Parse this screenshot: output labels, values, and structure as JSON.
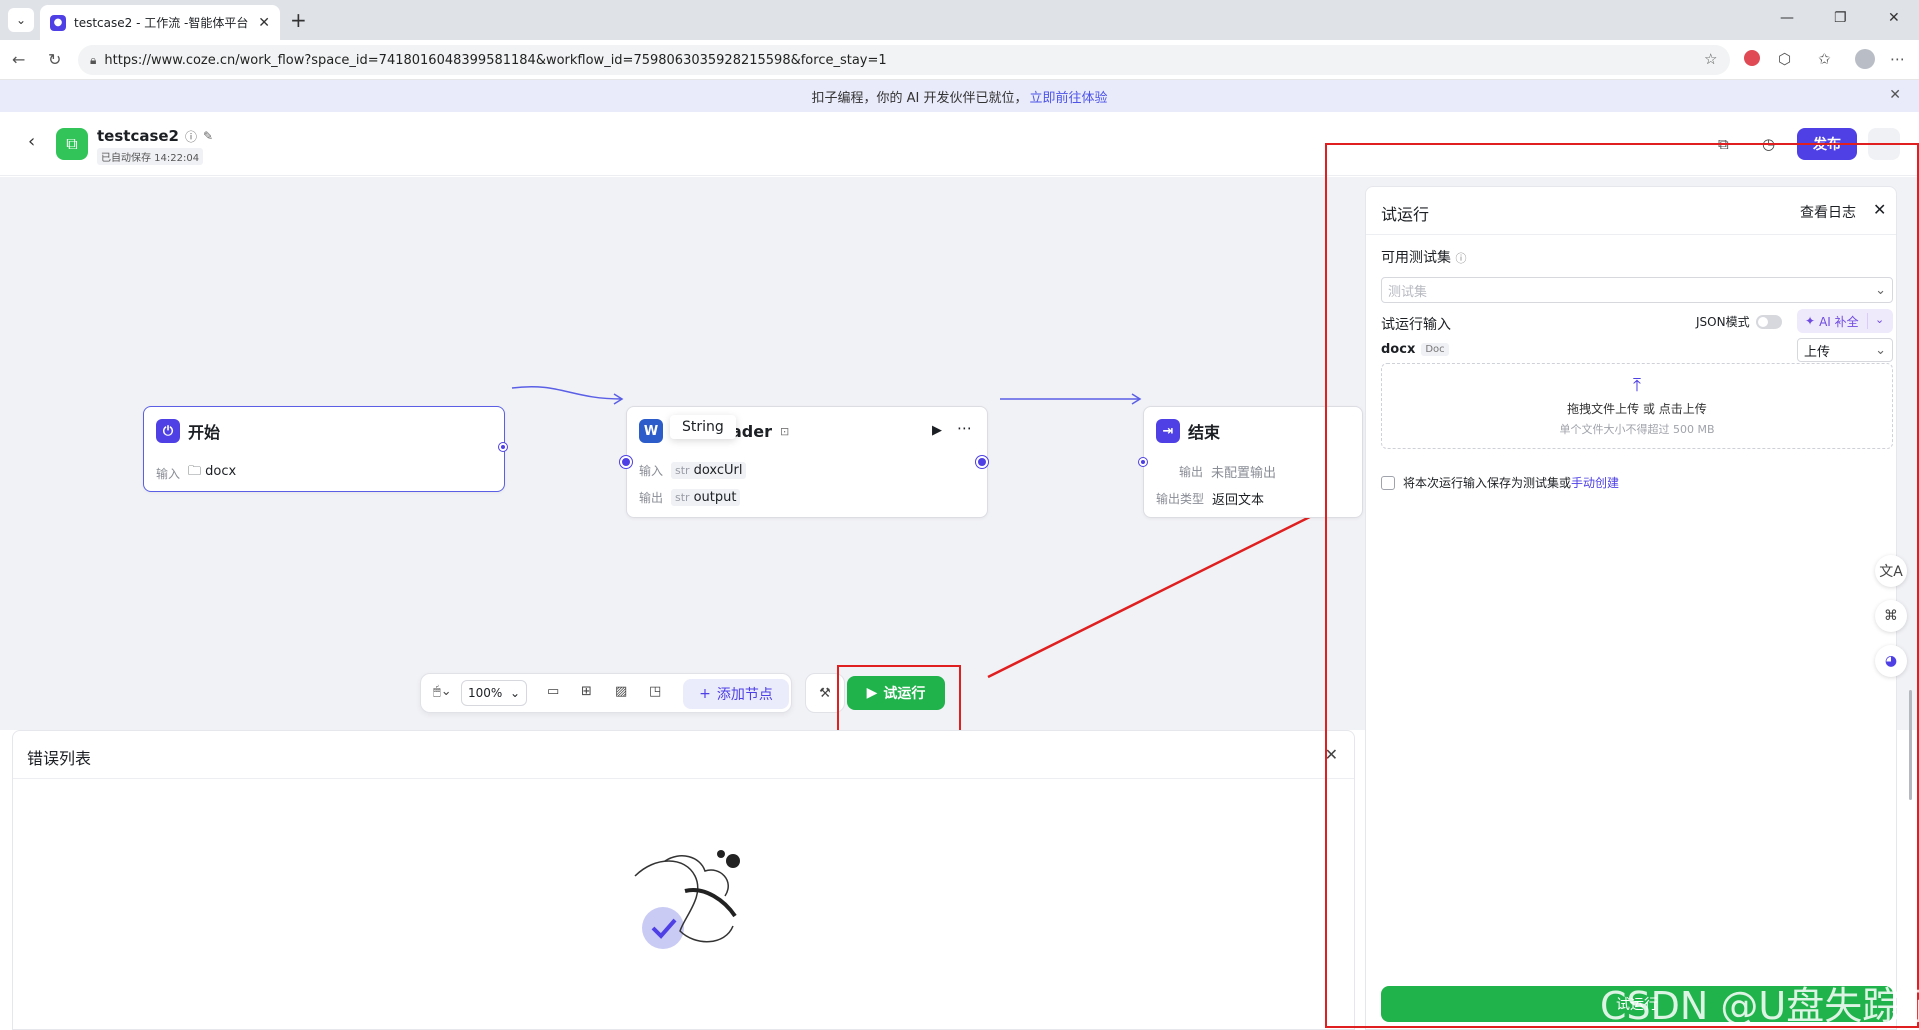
{
  "browser": {
    "tab_title": "testcase2 - 工作流 -智能体平台",
    "url": "https://www.coze.cn/work_flow?space_id=7418016048399581184&workflow_id=7598063035928215598&force_stay=1"
  },
  "banner": {
    "text": "扣子编程，你的 AI 开发伙伴已就位，",
    "link": "立即前往体验"
  },
  "header": {
    "app_name": "testcase2",
    "saved": "已自动保存 14:22:04",
    "publish": "发布"
  },
  "nodes": {
    "start": {
      "title": "开始",
      "input_label": "输入",
      "input_value": "docx"
    },
    "reader": {
      "title_left": "",
      "title_right": "ader",
      "input_label": "输入",
      "input_type": "str",
      "input_value": "doxcUrl",
      "output_label": "输出",
      "output_type": "str",
      "output_value": "output",
      "tooltip": "String"
    },
    "end": {
      "title": "结束",
      "output_label": "输出",
      "output_value": "未配置输出",
      "output_type_label": "输出类型",
      "output_type_value": "返回文本"
    }
  },
  "toolbar": {
    "zoom": "100%",
    "add_node": "添加节点",
    "run": "试运行"
  },
  "error_panel": {
    "title": "错误列表"
  },
  "run_panel": {
    "title": "试运行",
    "view_log": "查看日志",
    "testset_label": "可用测试集",
    "testset_placeholder": "测试集",
    "input_label": "试运行输入",
    "json_mode": "JSON模式",
    "ai_complete": "AI 补全",
    "field_name": "docx",
    "field_type": "Doc",
    "upload_select": "上传",
    "drop_text": "拖拽文件上传 或 点击上传",
    "drop_hint": "单个文件大小不得超过 500 MB",
    "save_text": "将本次运行输入保存为测试集或",
    "save_link": "手动创建",
    "run_button": "试运行"
  },
  "watermark": "CSDN @U盘失踪了",
  "colors": {
    "brand": "#4e40e5",
    "run_green": "#20b34c",
    "annotation_red": "#e02020"
  }
}
